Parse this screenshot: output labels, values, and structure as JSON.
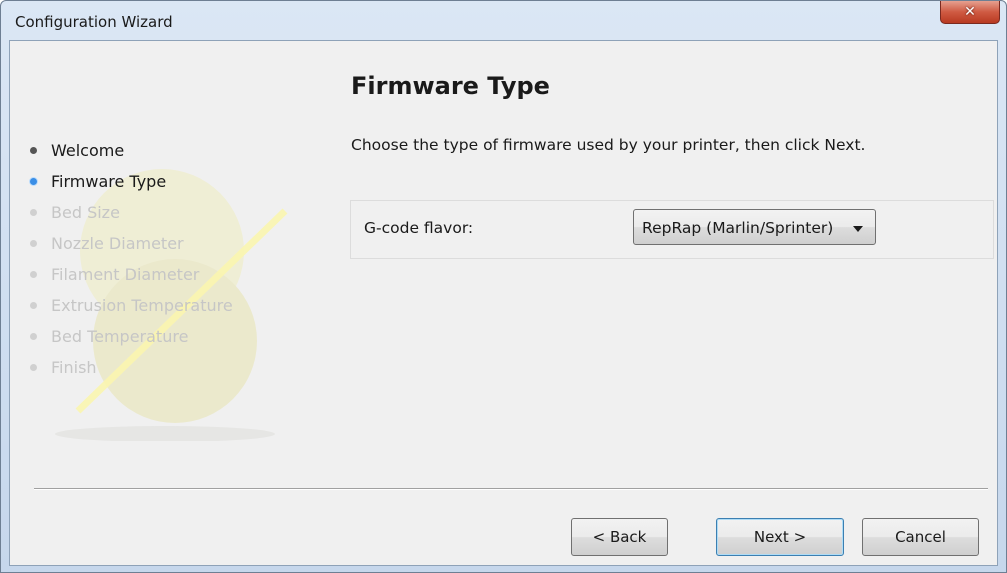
{
  "window": {
    "title": "Configuration Wizard"
  },
  "page": {
    "title": "Firmware Type",
    "description": "Choose the type of firmware used by your printer, then click Next."
  },
  "steps": [
    {
      "label": "Welcome",
      "state": "done"
    },
    {
      "label": "Firmware Type",
      "state": "current"
    },
    {
      "label": "Bed Size",
      "state": "pending"
    },
    {
      "label": "Nozzle Diameter",
      "state": "pending"
    },
    {
      "label": "Filament Diameter",
      "state": "pending"
    },
    {
      "label": "Extrusion Temperature",
      "state": "pending"
    },
    {
      "label": "Bed Temperature",
      "state": "pending"
    },
    {
      "label": "Finish",
      "state": "pending"
    }
  ],
  "form": {
    "gcode_flavor": {
      "label": "G-code flavor:",
      "value": "RepRap (Marlin/Sprinter)"
    }
  },
  "buttons": {
    "back": "< Back",
    "next": "Next >",
    "cancel": "Cancel"
  },
  "colors": {
    "done": "#555555",
    "current": "#3a8ee6",
    "pending": "#d0d0d0",
    "artwork": "#eeeccf"
  },
  "icons": {
    "close": "close-icon",
    "dropdown": "chevron-down-icon",
    "artwork": "slic3r-logo"
  }
}
